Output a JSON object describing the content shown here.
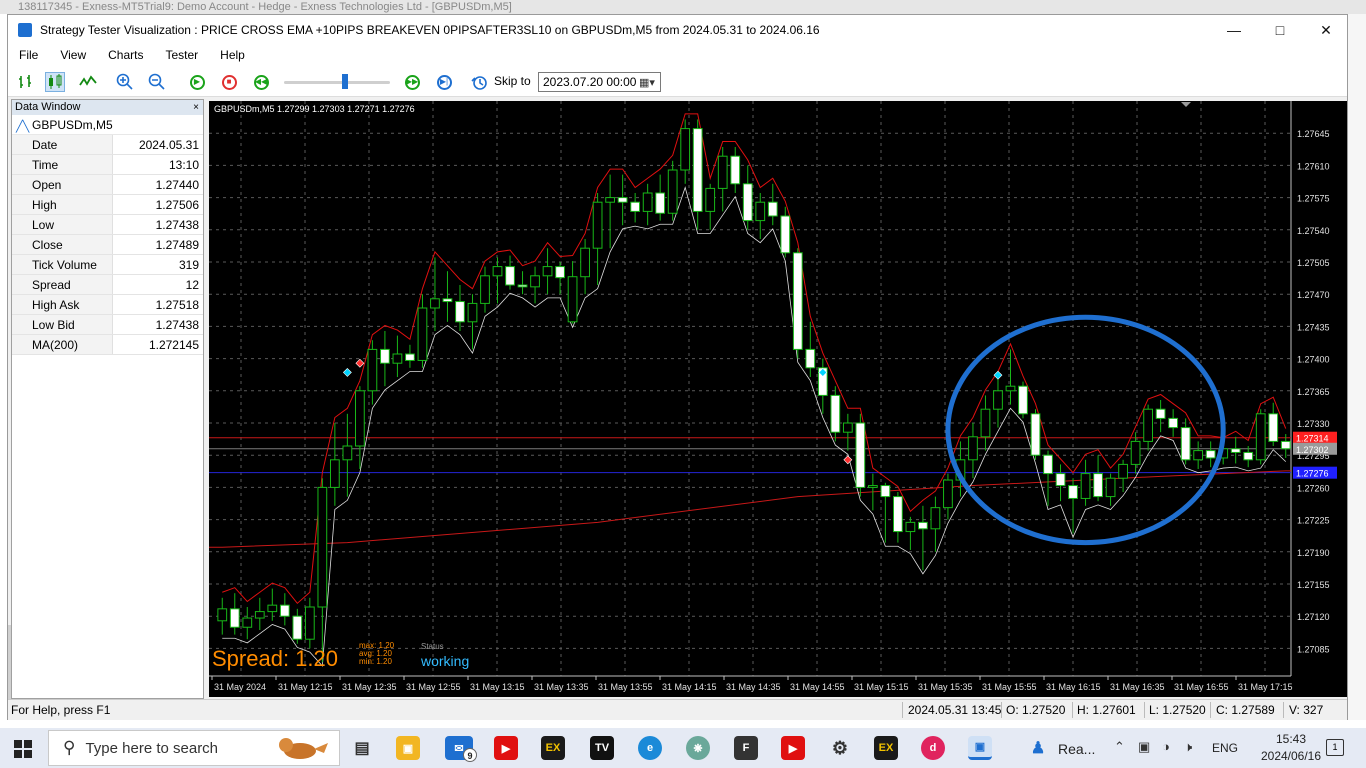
{
  "background_app_title": "138117345 - Exness-MT5Trial9: Demo Account - Hedge - Exness Technologies Ltd - [GBPUSDm,M5]",
  "window": {
    "title": "Strategy Tester Visualization : PRICE CROSS EMA +10PIPS BREAKEVEN 0PIPSAFTER3SL10 on GBPUSDm,M5 from 2024.05.31 to 2024.06.16",
    "minimize_icon": "minimize-icon",
    "maximize_icon": "maximize-icon",
    "close_icon": "close-icon"
  },
  "menu": [
    "File",
    "View",
    "Charts",
    "Tester",
    "Help"
  ],
  "toolbar": {
    "skip_label": "Skip to",
    "skip_value": "2023.07.20 00:00",
    "slider_position": 0.55
  },
  "data_window": {
    "title": "Data Window",
    "close": "×",
    "symbol": "GBPUSDm,M5",
    "rows": [
      {
        "key": "Date",
        "value": "2024.05.31"
      },
      {
        "key": "Time",
        "value": "13:10"
      },
      {
        "key": "Open",
        "value": "1.27440"
      },
      {
        "key": "High",
        "value": "1.27506"
      },
      {
        "key": "Low",
        "value": "1.27438"
      },
      {
        "key": "Close",
        "value": "1.27489"
      },
      {
        "key": "Tick Volume",
        "value": "319"
      },
      {
        "key": "Spread",
        "value": "12"
      },
      {
        "key": "High Ask",
        "value": "1.27518"
      },
      {
        "key": "Low Bid",
        "value": "1.27438"
      },
      {
        "key": "MA(200)",
        "value": "1.272145"
      }
    ]
  },
  "chart_header": "GBPUSDm,M5  1.27299 1.27303 1.27271 1.27276",
  "overlay": {
    "spread_text": "Spread: 1.20",
    "max_text": "max:  1.20",
    "avg_text": "avg:  1.20",
    "min_text": "min:  1.20",
    "status_label": "Status",
    "status_value": "working"
  },
  "chart_data": {
    "type": "candlestick",
    "symbol": "GBPUSDm",
    "timeframe": "M5",
    "ylim": [
      1.27055,
      1.2768
    ],
    "y_ticks": [
      "1.27645",
      "1.27610",
      "1.27575",
      "1.27540",
      "1.27505",
      "1.27470",
      "1.27435",
      "1.27400",
      "1.27365",
      "1.27330",
      "1.27295",
      "1.27260",
      "1.27225",
      "1.27190",
      "1.27155",
      "1.27120",
      "1.27085"
    ],
    "x_ticks": [
      "31 May 2024",
      "31 May 12:15",
      "31 May 12:35",
      "31 May 12:55",
      "31 May 13:15",
      "31 May 13:35",
      "31 May 13:55",
      "31 May 14:15",
      "31 May 14:35",
      "31 May 14:55",
      "31 May 15:15",
      "31 May 15:35",
      "31 May 15:55",
      "31 May 16:15",
      "31 May 16:35",
      "31 May 16:55",
      "31 May 17:15"
    ],
    "price_labels": [
      {
        "text": "1.27314",
        "value": 1.27314,
        "color": "#ff2020"
      },
      {
        "text": "1.27302",
        "value": 1.27302,
        "color": "#9a9a9a"
      },
      {
        "text": "1.27276",
        "value": 1.27276,
        "color": "#2020ff"
      }
    ],
    "hlines": [
      {
        "value": 1.27314,
        "color": "#c81818"
      },
      {
        "value": 1.27302,
        "color": "#7a7a7a"
      },
      {
        "value": 1.27276,
        "color": "#2424d8"
      }
    ],
    "candles": [
      [
        1.27115,
        1.2714,
        1.271,
        1.27128
      ],
      [
        1.27128,
        1.27145,
        1.271,
        1.27108
      ],
      [
        1.27108,
        1.2713,
        1.27095,
        1.27118
      ],
      [
        1.27118,
        1.2714,
        1.27105,
        1.27125
      ],
      [
        1.27125,
        1.2715,
        1.27115,
        1.27132
      ],
      [
        1.27132,
        1.27145,
        1.2711,
        1.2712
      ],
      [
        1.2712,
        1.27128,
        1.2709,
        1.27095
      ],
      [
        1.27095,
        1.2714,
        1.27085,
        1.2713
      ],
      [
        1.2713,
        1.2727,
        1.2707,
        1.2726
      ],
      [
        1.2726,
        1.2733,
        1.2724,
        1.2729
      ],
      [
        1.2729,
        1.2734,
        1.2725,
        1.27305
      ],
      [
        1.27305,
        1.2737,
        1.2728,
        1.27365
      ],
      [
        1.27365,
        1.2742,
        1.2735,
        1.2741
      ],
      [
        1.2741,
        1.2743,
        1.2737,
        1.27395
      ],
      [
        1.27395,
        1.27425,
        1.2738,
        1.27405
      ],
      [
        1.27405,
        1.27415,
        1.2739,
        1.27398
      ],
      [
        1.27398,
        1.2747,
        1.2739,
        1.27455
      ],
      [
        1.27455,
        1.2751,
        1.2743,
        1.27465
      ],
      [
        1.27465,
        1.27495,
        1.2744,
        1.27462
      ],
      [
        1.27462,
        1.2748,
        1.2743,
        1.2744
      ],
      [
        1.2744,
        1.2747,
        1.2741,
        1.2746
      ],
      [
        1.2746,
        1.275,
        1.2745,
        1.2749
      ],
      [
        1.2749,
        1.2751,
        1.2746,
        1.275
      ],
      [
        1.275,
        1.27512,
        1.27475,
        1.2748
      ],
      [
        1.2748,
        1.27495,
        1.2747,
        1.27478
      ],
      [
        1.27478,
        1.275,
        1.2746,
        1.2749
      ],
      [
        1.2749,
        1.2752,
        1.2747,
        1.275
      ],
      [
        1.275,
        1.27505,
        1.2747,
        1.27488
      ],
      [
        1.2744,
        1.27506,
        1.27438,
        1.27489
      ],
      [
        1.27489,
        1.2753,
        1.2747,
        1.2752
      ],
      [
        1.2752,
        1.2758,
        1.2748,
        1.2757
      ],
      [
        1.2757,
        1.276,
        1.2752,
        1.27575
      ],
      [
        1.27575,
        1.276,
        1.27545,
        1.2757
      ],
      [
        1.2757,
        1.2758,
        1.27548,
        1.2756
      ],
      [
        1.2756,
        1.2759,
        1.27545,
        1.2758
      ],
      [
        1.2758,
        1.276,
        1.2755,
        1.27558
      ],
      [
        1.27558,
        1.27615,
        1.2755,
        1.27605
      ],
      [
        1.27605,
        1.2766,
        1.2759,
        1.2765
      ],
      [
        1.2765,
        1.2766,
        1.2754,
        1.2756
      ],
      [
        1.2756,
        1.2759,
        1.2754,
        1.27585
      ],
      [
        1.27585,
        1.2763,
        1.2756,
        1.2762
      ],
      [
        1.2762,
        1.2763,
        1.2758,
        1.2759
      ],
      [
        1.2759,
        1.2761,
        1.2754,
        1.2755
      ],
      [
        1.2755,
        1.2758,
        1.2753,
        1.2757
      ],
      [
        1.2757,
        1.2759,
        1.27545,
        1.27555
      ],
      [
        1.27555,
        1.27565,
        1.2751,
        1.27515
      ],
      [
        1.27515,
        1.2752,
        1.274,
        1.2741
      ],
      [
        1.2741,
        1.2744,
        1.2738,
        1.2739
      ],
      [
        1.2739,
        1.274,
        1.2734,
        1.2736
      ],
      [
        1.2736,
        1.2737,
        1.2731,
        1.2732
      ],
      [
        1.2732,
        1.2734,
        1.273,
        1.2733
      ],
      [
        1.2733,
        1.2734,
        1.2725,
        1.2726
      ],
      [
        1.2726,
        1.27275,
        1.27235,
        1.27262
      ],
      [
        1.27262,
        1.27265,
        1.272,
        1.2725
      ],
      [
        1.2725,
        1.27255,
        1.272,
        1.27212
      ],
      [
        1.27212,
        1.27228,
        1.27192,
        1.27222
      ],
      [
        1.27222,
        1.2724,
        1.2717,
        1.27215
      ],
      [
        1.27215,
        1.2725,
        1.2719,
        1.27238
      ],
      [
        1.27238,
        1.27275,
        1.27225,
        1.27268
      ],
      [
        1.27268,
        1.2731,
        1.2725,
        1.2729
      ],
      [
        1.2729,
        1.2733,
        1.2727,
        1.27315
      ],
      [
        1.27315,
        1.2736,
        1.273,
        1.27345
      ],
      [
        1.27345,
        1.2738,
        1.27325,
        1.27365
      ],
      [
        1.27365,
        1.2741,
        1.2735,
        1.2737
      ],
      [
        1.2737,
        1.27375,
        1.27335,
        1.2734
      ],
      [
        1.2734,
        1.27345,
        1.2729,
        1.27295
      ],
      [
        1.27295,
        1.273,
        1.2724,
        1.27275
      ],
      [
        1.27275,
        1.27285,
        1.27245,
        1.27262
      ],
      [
        1.27262,
        1.2727,
        1.2721,
        1.27248
      ],
      [
        1.27248,
        1.2729,
        1.2724,
        1.27275
      ],
      [
        1.27275,
        1.27295,
        1.27245,
        1.2725
      ],
      [
        1.2725,
        1.27275,
        1.2724,
        1.2727
      ],
      [
        1.2727,
        1.2729,
        1.27255,
        1.27285
      ],
      [
        1.27285,
        1.2732,
        1.27275,
        1.2731
      ],
      [
        1.2731,
        1.2735,
        1.273,
        1.27345
      ],
      [
        1.27345,
        1.27355,
        1.2732,
        1.27335
      ],
      [
        1.27335,
        1.27345,
        1.27315,
        1.27325
      ],
      [
        1.27325,
        1.27335,
        1.27285,
        1.2729
      ],
      [
        1.2729,
        1.2731,
        1.2728,
        1.273
      ],
      [
        1.273,
        1.2731,
        1.27282,
        1.27292
      ],
      [
        1.27292,
        1.27308,
        1.27285,
        1.27302
      ],
      [
        1.27302,
        1.27315,
        1.27286,
        1.27298
      ],
      [
        1.27298,
        1.27305,
        1.27282,
        1.2729
      ],
      [
        1.2729,
        1.27345,
        1.27285,
        1.2734
      ],
      [
        1.2734,
        1.27352,
        1.27305,
        1.2731
      ],
      [
        1.2731,
        1.27318,
        1.27292,
        1.27302
      ]
    ],
    "ma200": [
      [
        0,
        1.27195
      ],
      [
        10,
        1.272
      ],
      [
        30,
        1.27222
      ],
      [
        46,
        1.2725
      ],
      [
        60,
        1.27262
      ],
      [
        75,
        1.27272
      ],
      [
        85,
        1.27278
      ]
    ],
    "markers": [
      {
        "index": 10,
        "value": 1.27385,
        "color": "#00d4ff"
      },
      {
        "index": 11,
        "value": 1.27395,
        "color": "#ff3030"
      },
      {
        "index": 48,
        "value": 1.27385,
        "color": "#00d4ff"
      },
      {
        "index": 50,
        "value": 1.2729,
        "color": "#ff3030"
      },
      {
        "index": 62,
        "value": 1.27382,
        "color": "#00d4ff"
      }
    ],
    "annotation": {
      "shape": "ellipse",
      "color": "#1f6fd0",
      "start_index": 58,
      "end_index": 80,
      "top": 1.27445,
      "bottom": 1.272
    }
  },
  "statusbar": {
    "help": "For Help, press F1",
    "datetime": "2024.05.31 13:45",
    "open": "O: 1.27520",
    "high": "H: 1.27601",
    "low": "L: 1.27520",
    "close": "C: 1.27589",
    "volume": "V: 327"
  },
  "taskbar": {
    "search_placeholder": "Type here to search",
    "mail_badge": "9",
    "rea_label": "Rea...",
    "language": "ENG",
    "time": "15:43",
    "date": "2024/06/16",
    "notifications": "1"
  },
  "colors": {
    "bull": "#18b818",
    "bear": "#ffffff",
    "envelope_upper": "#e01010",
    "envelope_lower": "#e0e0e0",
    "ma": "#c81818",
    "grid": "#5a5a5a",
    "spread": "#ff8c00",
    "status": "#33bbff"
  }
}
